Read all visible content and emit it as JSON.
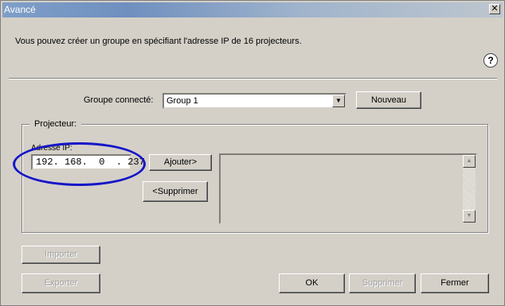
{
  "window": {
    "title": "Avancé",
    "close_glyph": "✕"
  },
  "intro_text": "Vous pouvez créer un groupe en spécifiant l'adresse IP de 16 projecteurs.",
  "help_icon_glyph": "?",
  "group": {
    "label": "Groupe connecté:",
    "selected": "Group 1",
    "new_button": "Nouveau"
  },
  "projector": {
    "legend": "Projecteur:",
    "ip_label": "Adresse IP:",
    "ip_value": "192. 168.  0  . 237",
    "add_button": "Ajouter>",
    "remove_button": "<Supprimer",
    "list_items": []
  },
  "footer": {
    "import_button": "Importer",
    "export_button": "Exporter",
    "ok_button": "OK",
    "delete_button": "Supprimer",
    "close_button": "Fermer"
  },
  "icons": {
    "dropdown": "chevron-down-icon",
    "scroll_up": "arrow-up-icon",
    "scroll_down": "arrow-down-icon",
    "help": "help-icon"
  },
  "colors": {
    "annotation_ellipse": "#1515c8",
    "dialog_face": "#d4d0c8"
  }
}
